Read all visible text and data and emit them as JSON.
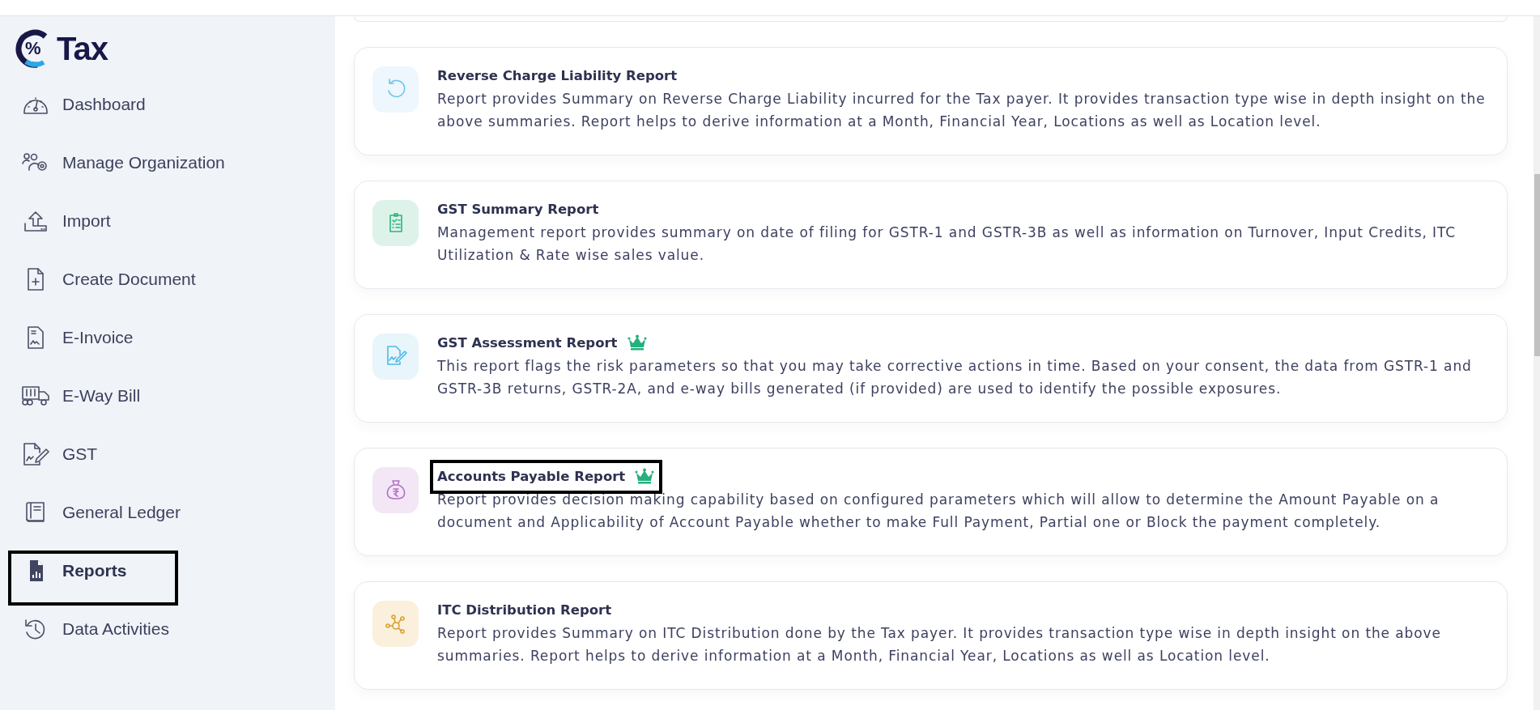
{
  "logo": {
    "mark": "%",
    "text": "Tax"
  },
  "sidebar": {
    "items": [
      {
        "label": "Dashboard",
        "selected": false,
        "highlighted": false
      },
      {
        "label": "Manage Organization",
        "selected": false,
        "highlighted": false
      },
      {
        "label": "Import",
        "selected": false,
        "highlighted": false
      },
      {
        "label": "Create Document",
        "selected": false,
        "highlighted": false
      },
      {
        "label": "E-Invoice",
        "selected": false,
        "highlighted": false
      },
      {
        "label": "E-Way Bill",
        "selected": false,
        "highlighted": false
      },
      {
        "label": "GST",
        "selected": false,
        "highlighted": false
      },
      {
        "label": "General Ledger",
        "selected": false,
        "highlighted": false
      },
      {
        "label": "Reports",
        "selected": true,
        "highlighted": true
      },
      {
        "label": "Data Activities",
        "selected": false,
        "highlighted": false
      }
    ]
  },
  "reports": [
    {
      "title": "Reverse Charge Liability Report",
      "premium": false,
      "highlighted": false,
      "description": "Report provides Summary on Reverse Charge Liability incurred for the Tax payer. It provides transaction type wise in depth insight on the above summaries. Report helps to derive information at a Month, Financial Year, Locations as well as Location level."
    },
    {
      "title": "GST Summary Report",
      "premium": false,
      "highlighted": false,
      "description": "Management report provides summary on date of filing for GSTR-1 and GSTR-3B as well as information on Turnover, Input Credits, ITC Utilization & Rate wise sales value."
    },
    {
      "title": "GST Assessment Report",
      "premium": true,
      "highlighted": false,
      "description": "This report flags the risk parameters so that you may take corrective actions in time. Based on your consent, the data from GSTR-1 and GSTR-3B returns, GSTR-2A, and e-way bills generated (if provided) are used to identify the possible exposures."
    },
    {
      "title": "Accounts Payable Report",
      "premium": true,
      "highlighted": true,
      "description": "Report provides decision making capability based on configured parameters which will allow to determine the Amount Payable on a document and Applicability of Account Payable whether to make Full Payment, Partial one or Block the payment completely."
    },
    {
      "title": "ITC Distribution Report",
      "premium": false,
      "highlighted": false,
      "description": "Report provides Summary on ITC Distribution done by the Tax payer. It provides transaction type wise in depth insight on the above summaries. Report helps to derive information at a Month, Financial Year, Locations as well as Location level."
    }
  ]
}
